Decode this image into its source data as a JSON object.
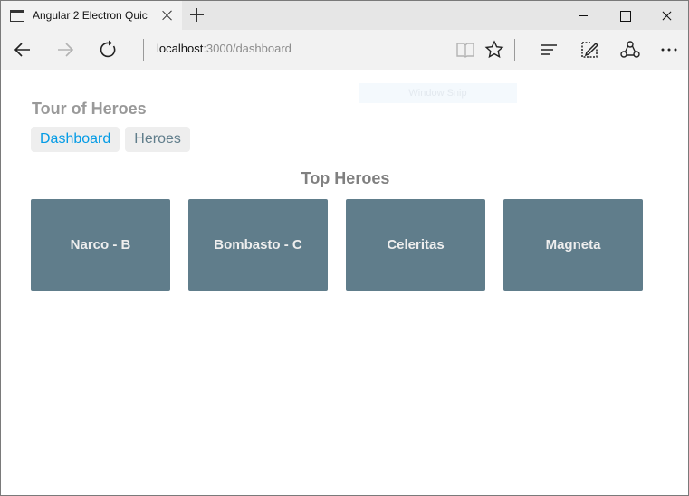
{
  "browser": {
    "tab_title": "Angular 2 Electron Quic",
    "address_host": "localhost",
    "address_path": ":3000/dashboard"
  },
  "overlay": {
    "snip_label": "Window Snip"
  },
  "app": {
    "title": "Tour of Heroes",
    "nav": [
      {
        "label": "Dashboard",
        "active": true
      },
      {
        "label": "Heroes",
        "active": false
      }
    ]
  },
  "dashboard": {
    "title": "Top Heroes",
    "heroes": [
      {
        "name": "Narco - B"
      },
      {
        "name": "Bombasto - C"
      },
      {
        "name": "Celeritas"
      },
      {
        "name": "Magneta"
      }
    ]
  },
  "colors": {
    "tile_bg": "#607d8b",
    "tile_text": "#eeeeee",
    "active_link": "#039be5",
    "link": "#607d8b",
    "title": "#999999"
  },
  "icons": [
    "tab-page-icon",
    "close-icon",
    "plus-icon",
    "minimize-icon",
    "maximize-icon",
    "back-arrow-icon",
    "forward-arrow-icon",
    "refresh-icon",
    "reading-view-icon",
    "favorite-star-icon",
    "hub-icon",
    "web-note-icon",
    "share-icon",
    "more-icon"
  ]
}
